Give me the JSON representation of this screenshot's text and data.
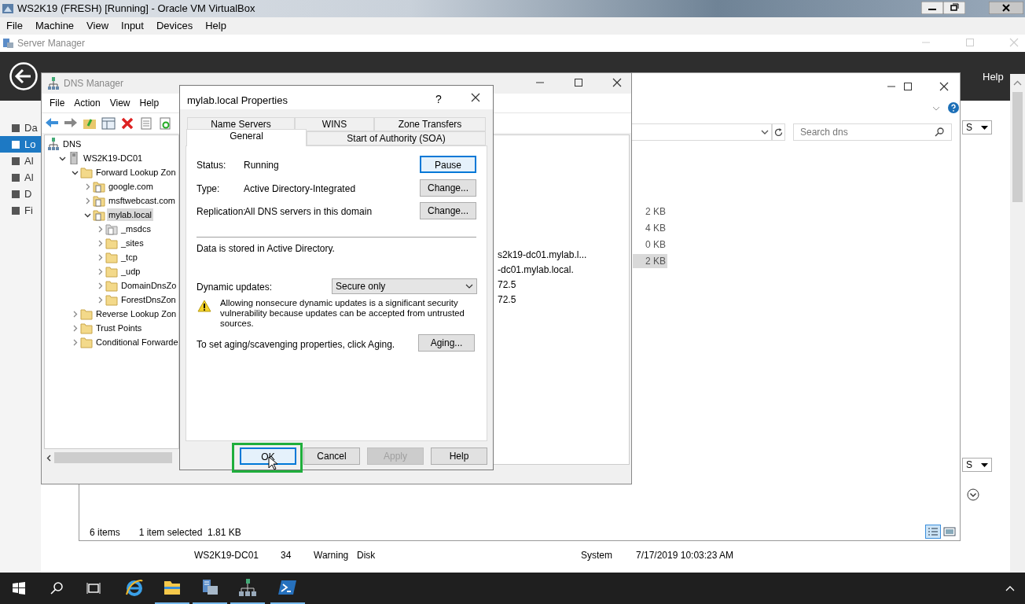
{
  "vm_window": {
    "title": "WS2K19 (FRESH) [Running] - Oracle VM VirtualBox",
    "menu": [
      "File",
      "Machine",
      "View",
      "Input",
      "Devices",
      "Help"
    ]
  },
  "server_manager": {
    "title": "Server Manager",
    "header_menu": [
      "Help"
    ],
    "nav": [
      {
        "label": "Da",
        "selected": false
      },
      {
        "label": "Lo",
        "selected": true
      },
      {
        "label": "Al",
        "selected": false
      },
      {
        "label": "Al",
        "selected": false
      },
      {
        "label": "D",
        "selected": false
      },
      {
        "label": "Fi",
        "selected": false
      }
    ],
    "dropdowns": [
      "S",
      "S"
    ],
    "event_row": [
      "WS2K19-DC01",
      "34",
      "Warning",
      "Disk",
      "System",
      "7/17/2019 10:03:23 AM"
    ]
  },
  "explorer": {
    "search": {
      "placeholder": "Search dns"
    },
    "sizes": [
      {
        "text": "2 KB",
        "selected": false
      },
      {
        "text": "4 KB",
        "selected": false
      },
      {
        "text": "0 KB",
        "selected": false
      },
      {
        "text": "2 KB",
        "selected": true
      }
    ],
    "status": [
      "6 items",
      "1 item selected  1.81 KB"
    ]
  },
  "dns_manager": {
    "title": "DNS Manager",
    "menu": [
      "File",
      "Action",
      "View",
      "Help"
    ],
    "tree": [
      {
        "label": "DNS",
        "kind": "root",
        "selected": false,
        "children": [
          {
            "label": "WS2K19-DC01",
            "kind": "server",
            "expanded": true,
            "selected": false,
            "children": [
              {
                "label": "Forward Lookup Zon",
                "kind": "folder",
                "expanded": true,
                "selected": false,
                "children": [
                  {
                    "label": "google.com",
                    "kind": "zone",
                    "expanded": false,
                    "selected": false
                  },
                  {
                    "label": "msftwebcast.com",
                    "kind": "zone",
                    "expanded": false,
                    "selected": false
                  },
                  {
                    "label": "mylab.local",
                    "kind": "zone",
                    "expanded": true,
                    "selected": true,
                    "children": [
                      {
                        "label": "_msdcs",
                        "kind": "delegation",
                        "expanded": false,
                        "selected": false
                      },
                      {
                        "label": "_sites",
                        "kind": "folder",
                        "expanded": false,
                        "selected": false
                      },
                      {
                        "label": "_tcp",
                        "kind": "folder",
                        "expanded": false,
                        "selected": false
                      },
                      {
                        "label": "_udp",
                        "kind": "folder",
                        "expanded": false,
                        "selected": false
                      },
                      {
                        "label": "DomainDnsZo",
                        "kind": "folder",
                        "expanded": false,
                        "selected": false
                      },
                      {
                        "label": "ForestDnsZon",
                        "kind": "folder",
                        "expanded": false,
                        "selected": false
                      }
                    ]
                  }
                ]
              },
              {
                "label": "Reverse Lookup Zon",
                "kind": "folder",
                "expanded": false,
                "selected": false
              },
              {
                "label": "Trust Points",
                "kind": "folder",
                "expanded": false,
                "selected": false
              },
              {
                "label": "Conditional Forwarde",
                "kind": "folder",
                "expanded": false,
                "selected": false
              }
            ]
          }
        ]
      }
    ],
    "right_pane": [
      "s2k19-dc01.mylab.l...",
      "-dc01.mylab.local.",
      "72.5",
      "72.5"
    ]
  },
  "dialog": {
    "title": "mylab.local Properties",
    "help": "?",
    "tab_rows": [
      [
        {
          "label": "Name Servers",
          "selected": false
        },
        {
          "label": "WINS",
          "selected": false
        },
        {
          "label": "Zone Transfers",
          "selected": false
        }
      ],
      [
        {
          "label": "General",
          "selected": true
        },
        {
          "label": "Start of Authority (SOA)",
          "selected": false
        }
      ]
    ],
    "fields": [
      {
        "label": "Status:",
        "value": "Running",
        "button": "Pause",
        "focused": true
      },
      {
        "label": "Type:",
        "value": "Active Directory-Integrated",
        "button": "Change...",
        "focused": false
      },
      {
        "label": "Replication:",
        "value": "All DNS servers in this domain",
        "button": "Change...",
        "focused": false
      }
    ],
    "storage_note": "Data is stored in Active Directory.",
    "dynamic_updates": {
      "label": "Dynamic updates:",
      "value": "Secure only"
    },
    "warning": "Allowing nonsecure dynamic updates is a significant security vulnerability because updates can be accepted from untrusted sources.",
    "aging": {
      "text": "To set aging/scavenging properties, click Aging.",
      "button": "Aging..."
    },
    "buttons": [
      {
        "label": "OK",
        "disabled": false,
        "highlighted": true
      },
      {
        "label": "Cancel",
        "disabled": false,
        "highlighted": false
      },
      {
        "label": "Apply",
        "disabled": true,
        "highlighted": false
      },
      {
        "label": "Help",
        "disabled": false,
        "highlighted": false
      }
    ]
  },
  "taskbar": {
    "apps": [
      {
        "kind": "ie",
        "running": false
      },
      {
        "kind": "explorer",
        "running": true
      },
      {
        "kind": "server-manager",
        "running": true
      },
      {
        "kind": "dns",
        "running": true
      },
      {
        "kind": "powershell",
        "running": true
      }
    ]
  }
}
